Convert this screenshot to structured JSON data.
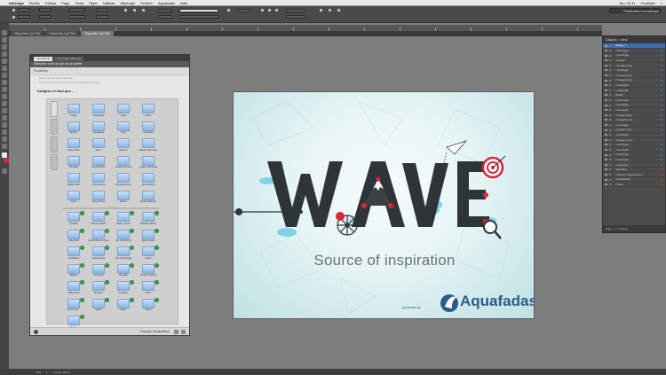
{
  "menubar": {
    "app": "InDesign",
    "items": [
      "Fichier",
      "Edition",
      "Page",
      "Texte",
      "Objet",
      "Tableau",
      "Affichage",
      "Fenêtre",
      "Aquafadas",
      "Aide"
    ],
    "clock": "Jeu. 10:11",
    "user": "Charlotte"
  },
  "controlbar": {
    "workspace": "Publication numérique"
  },
  "doc_tabs": [
    {
      "label": "*Sans titre-2 @ 75%",
      "active": false
    },
    {
      "label": "* Sans titre-3 @ 75%",
      "active": false
    },
    {
      "label": "*Sans titre-4 @ 75%",
      "active": true
    }
  ],
  "plugin": {
    "tabs": [
      "Interactivité",
      "Ad.Images Manager"
    ],
    "title": "Sélection: créé au pas de propriété",
    "section": "Propriétés",
    "checkbox1": "Basée depuis cette sélection",
    "checkbox2": "Ouvrir la panneau 'Créer' avec la sélection courante",
    "assign_label": "Assigner en tant que...",
    "footer_action": "Changer d'orientation",
    "grid": [
      [
        {
          "label": "Image",
          "check": false
        },
        {
          "label": "Diaporama",
          "check": false
        },
        {
          "label": "Vidéo",
          "check": false
        },
        {
          "label": "Audio",
          "check": false
        }
      ],
      [
        {
          "label": "Bouton",
          "check": false
        },
        {
          "label": "Visualiseur",
          "check": false
        },
        {
          "label": "Texte",
          "check": false
        },
        {
          "label": "Animation",
          "check": false
        }
      ],
      [
        {
          "label": "Page HTML",
          "check": false
        },
        {
          "label": "Zoom",
          "check": false
        },
        {
          "label": "Rollover",
          "check": false
        },
        {
          "label": "Masquer/Dévoiler",
          "check": false
        }
      ],
      [
        {
          "label": "Sensible",
          "check": false
        },
        {
          "label": "Jeu d'ombres",
          "check": false
        },
        {
          "label": "Lecteur de code",
          "check": false
        },
        {
          "label": "Image préchargée",
          "check": false
        }
      ],
      [
        {
          "label": "Effacer AVE",
          "check": false
        },
        {
          "label": "Lien externe",
          "check": false
        },
        {
          "label": "Enregistrement",
          "check": false
        },
        {
          "label": "Jeu d'échecs",
          "check": false
        }
      ],
      [
        {
          "label": "Ancre",
          "check": false
        },
        {
          "label": "Drag & Drop",
          "check": false
        },
        {
          "label": "Glisser",
          "check": false
        },
        {
          "label": "Bouton Bascule",
          "check": false
        }
      ],
      [
        {
          "label": "Variable",
          "check": true
        },
        {
          "label": "Puzzle Confirm",
          "check": true
        },
        {
          "label": "Mode Lecture",
          "check": true
        },
        {
          "label": "Bataille Navale",
          "check": true
        }
      ],
      [
        {
          "label": "Labyrinthe",
          "check": true
        },
        {
          "label": "Labyrinthe en temps",
          "check": true
        },
        {
          "label": "Jeu de Memory",
          "check": true
        },
        {
          "label": "Mots croisés",
          "check": true
        }
      ],
      [
        {
          "label": "Conditions",
          "check": true
        },
        {
          "label": "Gestionnaire",
          "check": true
        },
        {
          "label": "Jeu de Pointage",
          "check": true
        },
        {
          "label": "Action",
          "check": true
        }
      ],
      [
        {
          "label": "Balises",
          "check": true
        },
        {
          "label": "Compteur",
          "check": true
        },
        {
          "label": "Parallax",
          "check": true
        },
        {
          "label": "Jeu de 7 erreurs",
          "check": true
        }
      ],
      [
        {
          "label": "Différences",
          "check": true
        },
        {
          "label": "Rollover",
          "check": true
        },
        {
          "label": "Roulette",
          "check": true
        },
        {
          "label": "Arbre",
          "check": true
        }
      ],
      [
        {
          "label": "Nombre de ...",
          "check": true
        },
        {
          "label": "Scène",
          "check": true
        },
        {
          "label": "Barre",
          "check": true
        },
        {
          "label": "Score",
          "check": true
        }
      ],
      [
        {
          "label": "Bonus",
          "check": true
        }
      ]
    ]
  },
  "layers_panel": {
    "tabs": [
      "Calques",
      "Liens"
    ],
    "rows": [
      {
        "label": "Calque 1",
        "selected": true,
        "color": "#3d6db5"
      },
      {
        "label": "<rectangle>",
        "selected": false,
        "color": "#3d6db5"
      },
      {
        "label": "<rectangle>",
        "selected": false,
        "color": "#3d6db5"
      },
      {
        "label": "<Image>",
        "selected": false,
        "color": "#3d6db5"
      },
      {
        "label": "<Image1.png>",
        "selected": false,
        "color": "#3d6db5"
      },
      {
        "label": "<rectangle>",
        "selected": false,
        "color": "#3d6db5"
      },
      {
        "label": "<Image2.png>",
        "selected": false,
        "color": "#3d6db5"
      },
      {
        "label": "<Image3.png>",
        "selected": false,
        "color": "#3d6db5"
      },
      {
        "label": "<rectangle>",
        "selected": false,
        "color": "#3d6db5"
      },
      {
        "label": "<rectangle>",
        "selected": false,
        "color": "#3d6db5"
      },
      {
        "label": "WAVE",
        "selected": false,
        "color": "#3d6db5"
      },
      {
        "label": "<rectangle>",
        "selected": false,
        "color": "#3d6db5"
      },
      {
        "label": "<rectangle>",
        "selected": false,
        "color": "#3d6db5"
      },
      {
        "label": "<rectangle>",
        "selected": false,
        "color": "#3d6db5"
      },
      {
        "label": "<Image4.png>",
        "selected": false,
        "color": "#3d6db5"
      },
      {
        "label": "<Image5.png>",
        "selected": false,
        "color": "#3d6db5"
      },
      {
        "label": "<rectangle>",
        "selected": false,
        "color": "#3d6db5"
      },
      {
        "label": "<Image6.png>",
        "selected": false,
        "color": "#3d6db5"
      },
      {
        "label": "<rectangle>",
        "selected": false,
        "color": "#3d6db5"
      },
      {
        "label": "<Image7.png>",
        "selected": false,
        "color": "#3d6db5"
      },
      {
        "label": "<rectangle>",
        "selected": false,
        "color": "#3d6db5"
      },
      {
        "label": "<rectangle>",
        "selected": false,
        "color": "#3d6db5"
      },
      {
        "label": "<rectangle>",
        "selected": false,
        "color": "#3d6db5"
      },
      {
        "label": "<rectangle>",
        "selected": false,
        "color": "#3d6db5"
      },
      {
        "label": "<rectangle>",
        "selected": false,
        "color": "#3d6db5"
      },
      {
        "label": "Animation",
        "selected": false,
        "color": "#c0392b"
      },
      {
        "label": "<Source of inspiration>",
        "selected": false,
        "color": "#c0392b"
      },
      {
        "label": "<Aquafadas>",
        "selected": false,
        "color": "#c0392b"
      },
      {
        "label": "<Vide>",
        "selected": false,
        "color": "#c0392b"
      }
    ],
    "footer": "Page : 1, 2 calques"
  },
  "page_content": {
    "headline": "WAVE",
    "tagline": "Source of inspiration",
    "powered_by": "powered by",
    "brand": "Aquafadas"
  },
  "statusbar": {
    "zoom": "75%",
    "page": "1",
    "errors": "Aucune erreur"
  },
  "colors": {
    "accent_blue": "#2d5c8a",
    "letter_dark": "#2f3438",
    "highlight_red": "#d9263b",
    "page_cyan": "#bfe1e4"
  }
}
